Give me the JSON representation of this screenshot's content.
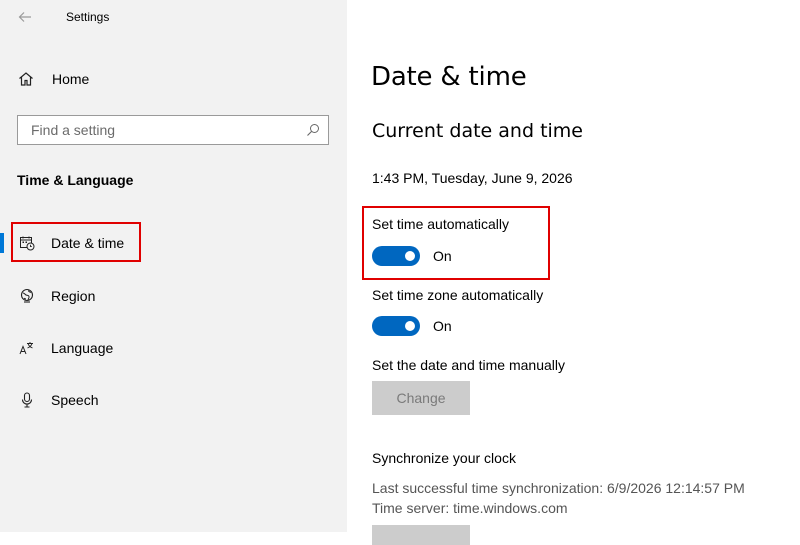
{
  "window": {
    "title": "Settings"
  },
  "sidebar": {
    "home_label": "Home",
    "search_placeholder": "Find a setting",
    "section_title": "Time & Language",
    "items": [
      {
        "label": "Date & time",
        "icon": "calendar-clock-icon",
        "selected": true
      },
      {
        "label": "Region",
        "icon": "globe-icon",
        "selected": false
      },
      {
        "label": "Language",
        "icon": "language-icon",
        "selected": false
      },
      {
        "label": "Speech",
        "icon": "microphone-icon",
        "selected": false
      }
    ]
  },
  "main": {
    "title": "Date & time",
    "subtitle": "Current date and time",
    "current_datetime": "1:43 PM, Tuesday, June 9, 2026",
    "set_time_auto": {
      "label": "Set time automatically",
      "state": "On"
    },
    "set_timezone_auto": {
      "label": "Set time zone automatically",
      "state": "On"
    },
    "manual": {
      "label": "Set the date and time manually",
      "button": "Change"
    },
    "sync": {
      "title": "Synchronize your clock",
      "last_sync": "Last successful time synchronization: 6/9/2026 12:14:57 PM",
      "server": "Time server: time.windows.com"
    }
  },
  "colors": {
    "accent": "#0067c0",
    "highlight": "#e00000",
    "sidebar_bg": "#f2f2f2"
  }
}
